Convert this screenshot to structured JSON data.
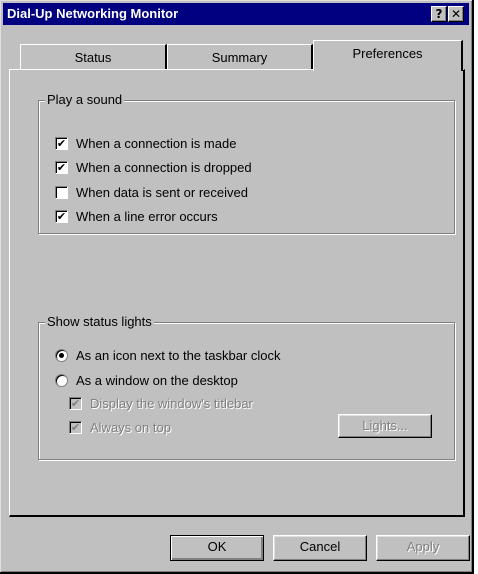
{
  "window": {
    "title": "Dial-Up Networking Monitor",
    "help_label": "?",
    "close_label": "✕"
  },
  "tabs": [
    {
      "label": "Status"
    },
    {
      "label": "Summary"
    },
    {
      "label": "Preferences",
      "selected": true
    }
  ],
  "sound_group": {
    "legend": "Play a sound",
    "options": [
      {
        "label": "When a connection is made",
        "checked": true,
        "mark": "✔"
      },
      {
        "label": "When a connection is dropped",
        "checked": true,
        "mark": "✔"
      },
      {
        "label": "When data is sent or received",
        "checked": false,
        "mark": ""
      },
      {
        "label": "When a line error occurs",
        "checked": true,
        "mark": "✔"
      }
    ]
  },
  "lights_group": {
    "legend": "Show status lights",
    "radio_options": [
      {
        "label": "As an icon next to the taskbar clock",
        "selected": true
      },
      {
        "label": "As a window on the desktop",
        "selected": false
      }
    ],
    "sub_options": [
      {
        "label": "Display the window's titlebar",
        "checked": true,
        "disabled": true,
        "mark": "✔"
      },
      {
        "label": "Always on top",
        "checked": true,
        "disabled": true,
        "mark": "✔"
      }
    ],
    "lights_button": "Lights..."
  },
  "footer": {
    "ok": "OK",
    "cancel": "Cancel",
    "apply": "Apply"
  }
}
